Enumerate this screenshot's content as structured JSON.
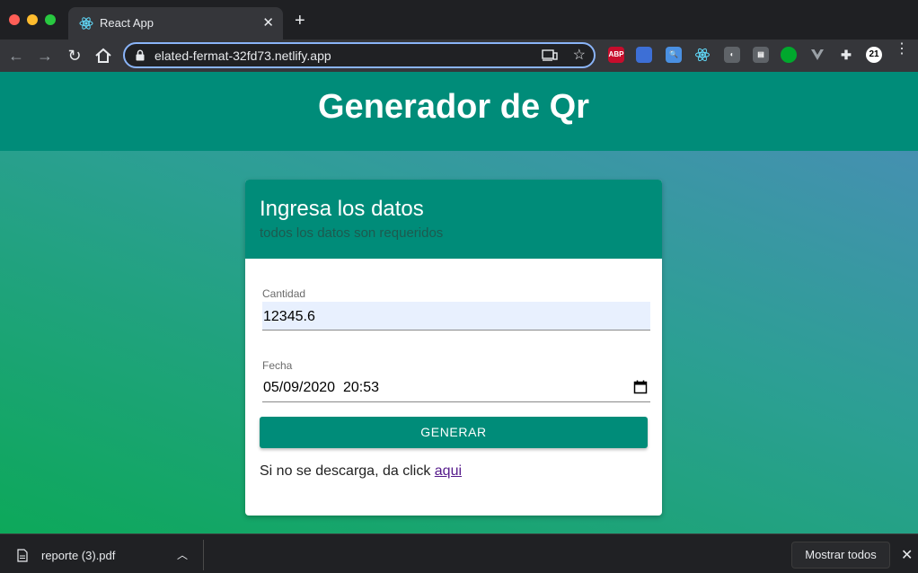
{
  "browser": {
    "tab_title": "React App",
    "url": "elated-fermat-32fd73.netlify.app",
    "extensions": [
      {
        "icon": "adblock-plus-icon",
        "label": "ABP",
        "color": "#c70d2c"
      },
      {
        "icon": "web-extension-icon",
        "label": "",
        "color": "#3d6fd6"
      },
      {
        "icon": "search-extension-icon",
        "label": "",
        "color": "#4a90e2"
      },
      {
        "icon": "react-devtools-icon",
        "label": "",
        "color": "#35363a"
      },
      {
        "icon": "bulb-extension-icon",
        "label": "",
        "color": "#5f6368"
      },
      {
        "icon": "window-extension-icon",
        "label": "",
        "color": "#5f6368"
      },
      {
        "icon": "evernote-icon",
        "label": "",
        "color": "#00a82d"
      },
      {
        "icon": "vue-devtools-icon",
        "label": "",
        "color": "#35363a"
      },
      {
        "icon": "puzzle-icon",
        "label": "",
        "color": "#35363a"
      },
      {
        "icon": "extension-21-icon",
        "label": "21",
        "color": "#ffffff"
      }
    ]
  },
  "page": {
    "title": "Generador de Qr",
    "card": {
      "title": "Ingresa los datos",
      "subtitle": "todos los datos son requeridos",
      "cantidad_label": "Cantidad",
      "cantidad_value": "12345.6",
      "fecha_label": "Fecha",
      "fecha_value": "05/09/2020  20:53",
      "button_label": "GENERAR",
      "note_text": "Si no se descarga, da click ",
      "note_link": "aqui"
    }
  },
  "download_bar": {
    "file_name": "reporte (3).pdf",
    "show_all": "Mostrar todos"
  },
  "colors": {
    "primary": "#008c79",
    "accent_link": "#551a8b"
  }
}
